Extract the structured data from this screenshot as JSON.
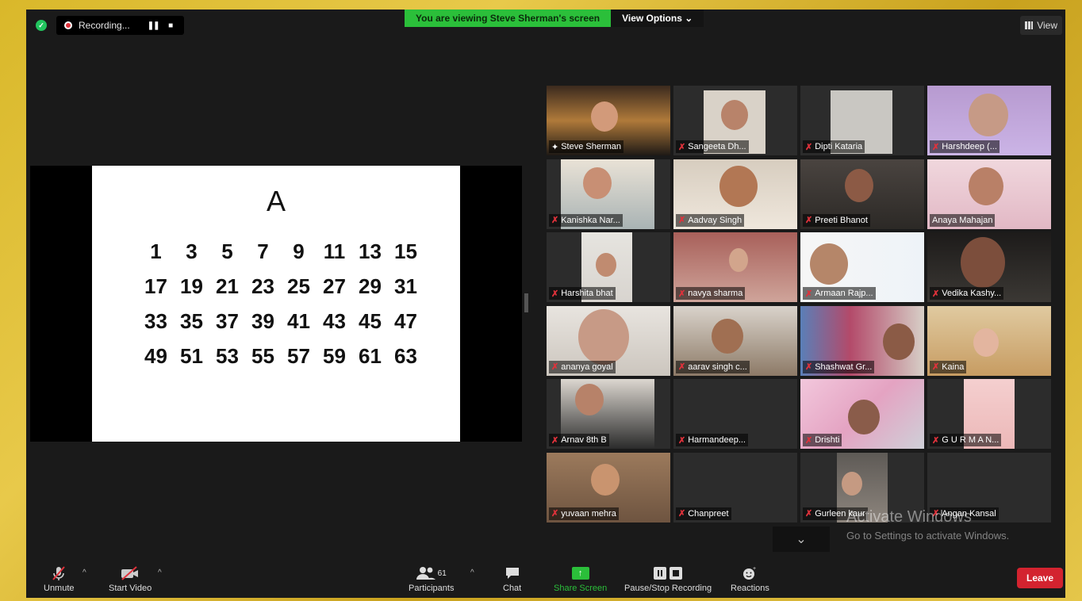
{
  "recording": {
    "status_text": "Recording...",
    "pause_icon": "pause-icon",
    "stop_icon": "stop-icon"
  },
  "banner": {
    "viewing_text": "You are viewing Steve Sherman's screen",
    "view_options_label": "View Options ⌄"
  },
  "view_button": {
    "label": "View",
    "icon": "grid-icon"
  },
  "slide": {
    "title": "A",
    "rows": [
      [
        "1",
        "3",
        "5",
        "7",
        "9",
        "11",
        "13",
        "15"
      ],
      [
        "17",
        "19",
        "21",
        "23",
        "25",
        "27",
        "29",
        "31"
      ],
      [
        "33",
        "35",
        "37",
        "39",
        "41",
        "43",
        "45",
        "47"
      ],
      [
        "49",
        "51",
        "53",
        "55",
        "57",
        "59",
        "61",
        "63"
      ]
    ]
  },
  "participants": [
    {
      "name": "Steve Sherman",
      "muted": false,
      "active": true
    },
    {
      "name": "Sangeeta Dh...",
      "muted": true
    },
    {
      "name": "Dipti Kataria",
      "muted": true
    },
    {
      "name": "Harshdeep (...",
      "muted": true
    },
    {
      "name": "Kanishka Nar...",
      "muted": true
    },
    {
      "name": "Aadvay Singh",
      "muted": true
    },
    {
      "name": "Preeti Bhanot",
      "muted": true
    },
    {
      "name": "Anaya Mahajan",
      "muted": false
    },
    {
      "name": "Harshita bhat",
      "muted": true
    },
    {
      "name": "navya sharma",
      "muted": true
    },
    {
      "name": "Armaan Rajp...",
      "muted": true
    },
    {
      "name": "Vedika Kashy...",
      "muted": true
    },
    {
      "name": "ananya goyal",
      "muted": true
    },
    {
      "name": "aarav singh c...",
      "muted": true
    },
    {
      "name": "Shashwat Gr...",
      "muted": true
    },
    {
      "name": "Kaina",
      "muted": true
    },
    {
      "name": "Arnav 8th B",
      "muted": true
    },
    {
      "name": "Harmandeep...",
      "muted": true
    },
    {
      "name": "Drishti",
      "muted": true
    },
    {
      "name": "G U R M A N...",
      "muted": true
    },
    {
      "name": "yuvaan mehra",
      "muted": true
    },
    {
      "name": "Chanpreet",
      "muted": true
    },
    {
      "name": "Gurleen kaur",
      "muted": true
    },
    {
      "name": "Angan Kansal",
      "muted": true
    }
  ],
  "watermark": {
    "line1": "Activate Windows",
    "line2": "Go to Settings to activate Windows."
  },
  "toolbar": {
    "unmute": "Unmute",
    "start_video": "Start Video",
    "participants": "Participants",
    "participants_count": "61",
    "chat": "Chat",
    "share_screen": "Share Screen",
    "pause_stop_recording": "Pause/Stop Recording",
    "reactions": "Reactions",
    "leave": "Leave"
  },
  "colors": {
    "accent_green": "#2bbf3a",
    "leave_red": "#d3232f",
    "active_outline": "#d7e34a"
  }
}
